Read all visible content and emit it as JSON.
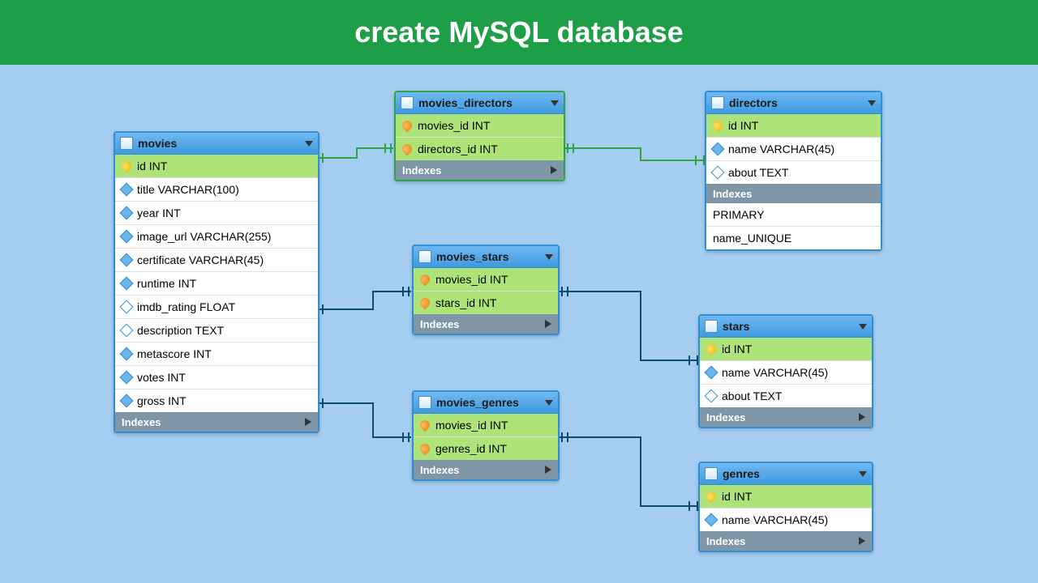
{
  "banner": "create MySQL database",
  "indexes_label": "Indexes",
  "tables": {
    "movies": {
      "name": "movies",
      "cols": [
        {
          "n": "id INT",
          "t": "pk"
        },
        {
          "n": "title VARCHAR(100)",
          "t": "col"
        },
        {
          "n": "year INT",
          "t": "col"
        },
        {
          "n": "image_url VARCHAR(255)",
          "t": "col"
        },
        {
          "n": "certificate VARCHAR(45)",
          "t": "col"
        },
        {
          "n": "runtime INT",
          "t": "col"
        },
        {
          "n": "imdb_rating FLOAT",
          "t": "col"
        },
        {
          "n": "description TEXT",
          "t": "col"
        },
        {
          "n": "metascore INT",
          "t": "col"
        },
        {
          "n": "votes INT",
          "t": "col"
        },
        {
          "n": "gross INT",
          "t": "col"
        }
      ]
    },
    "movies_directors": {
      "name": "movies_directors",
      "cols": [
        {
          "n": "movies_id INT",
          "t": "fk"
        },
        {
          "n": "directors_id INT",
          "t": "fk"
        }
      ]
    },
    "directors": {
      "name": "directors",
      "cols": [
        {
          "n": "id INT",
          "t": "pk"
        },
        {
          "n": "name VARCHAR(45)",
          "t": "col"
        },
        {
          "n": "about TEXT",
          "t": "col"
        }
      ],
      "index_entries": [
        "PRIMARY",
        "name_UNIQUE"
      ]
    },
    "movies_stars": {
      "name": "movies_stars",
      "cols": [
        {
          "n": "movies_id INT",
          "t": "fk"
        },
        {
          "n": "stars_id INT",
          "t": "fk"
        }
      ]
    },
    "stars": {
      "name": "stars",
      "cols": [
        {
          "n": "id INT",
          "t": "pk"
        },
        {
          "n": "name VARCHAR(45)",
          "t": "col"
        },
        {
          "n": "about TEXT",
          "t": "col"
        }
      ]
    },
    "movies_genres": {
      "name": "movies_genres",
      "cols": [
        {
          "n": "movies_id INT",
          "t": "fk"
        },
        {
          "n": "genres_id INT",
          "t": "fk"
        }
      ]
    },
    "genres": {
      "name": "genres",
      "cols": [
        {
          "n": "id INT",
          "t": "pk"
        },
        {
          "n": "name VARCHAR(45)",
          "t": "col"
        }
      ]
    }
  }
}
